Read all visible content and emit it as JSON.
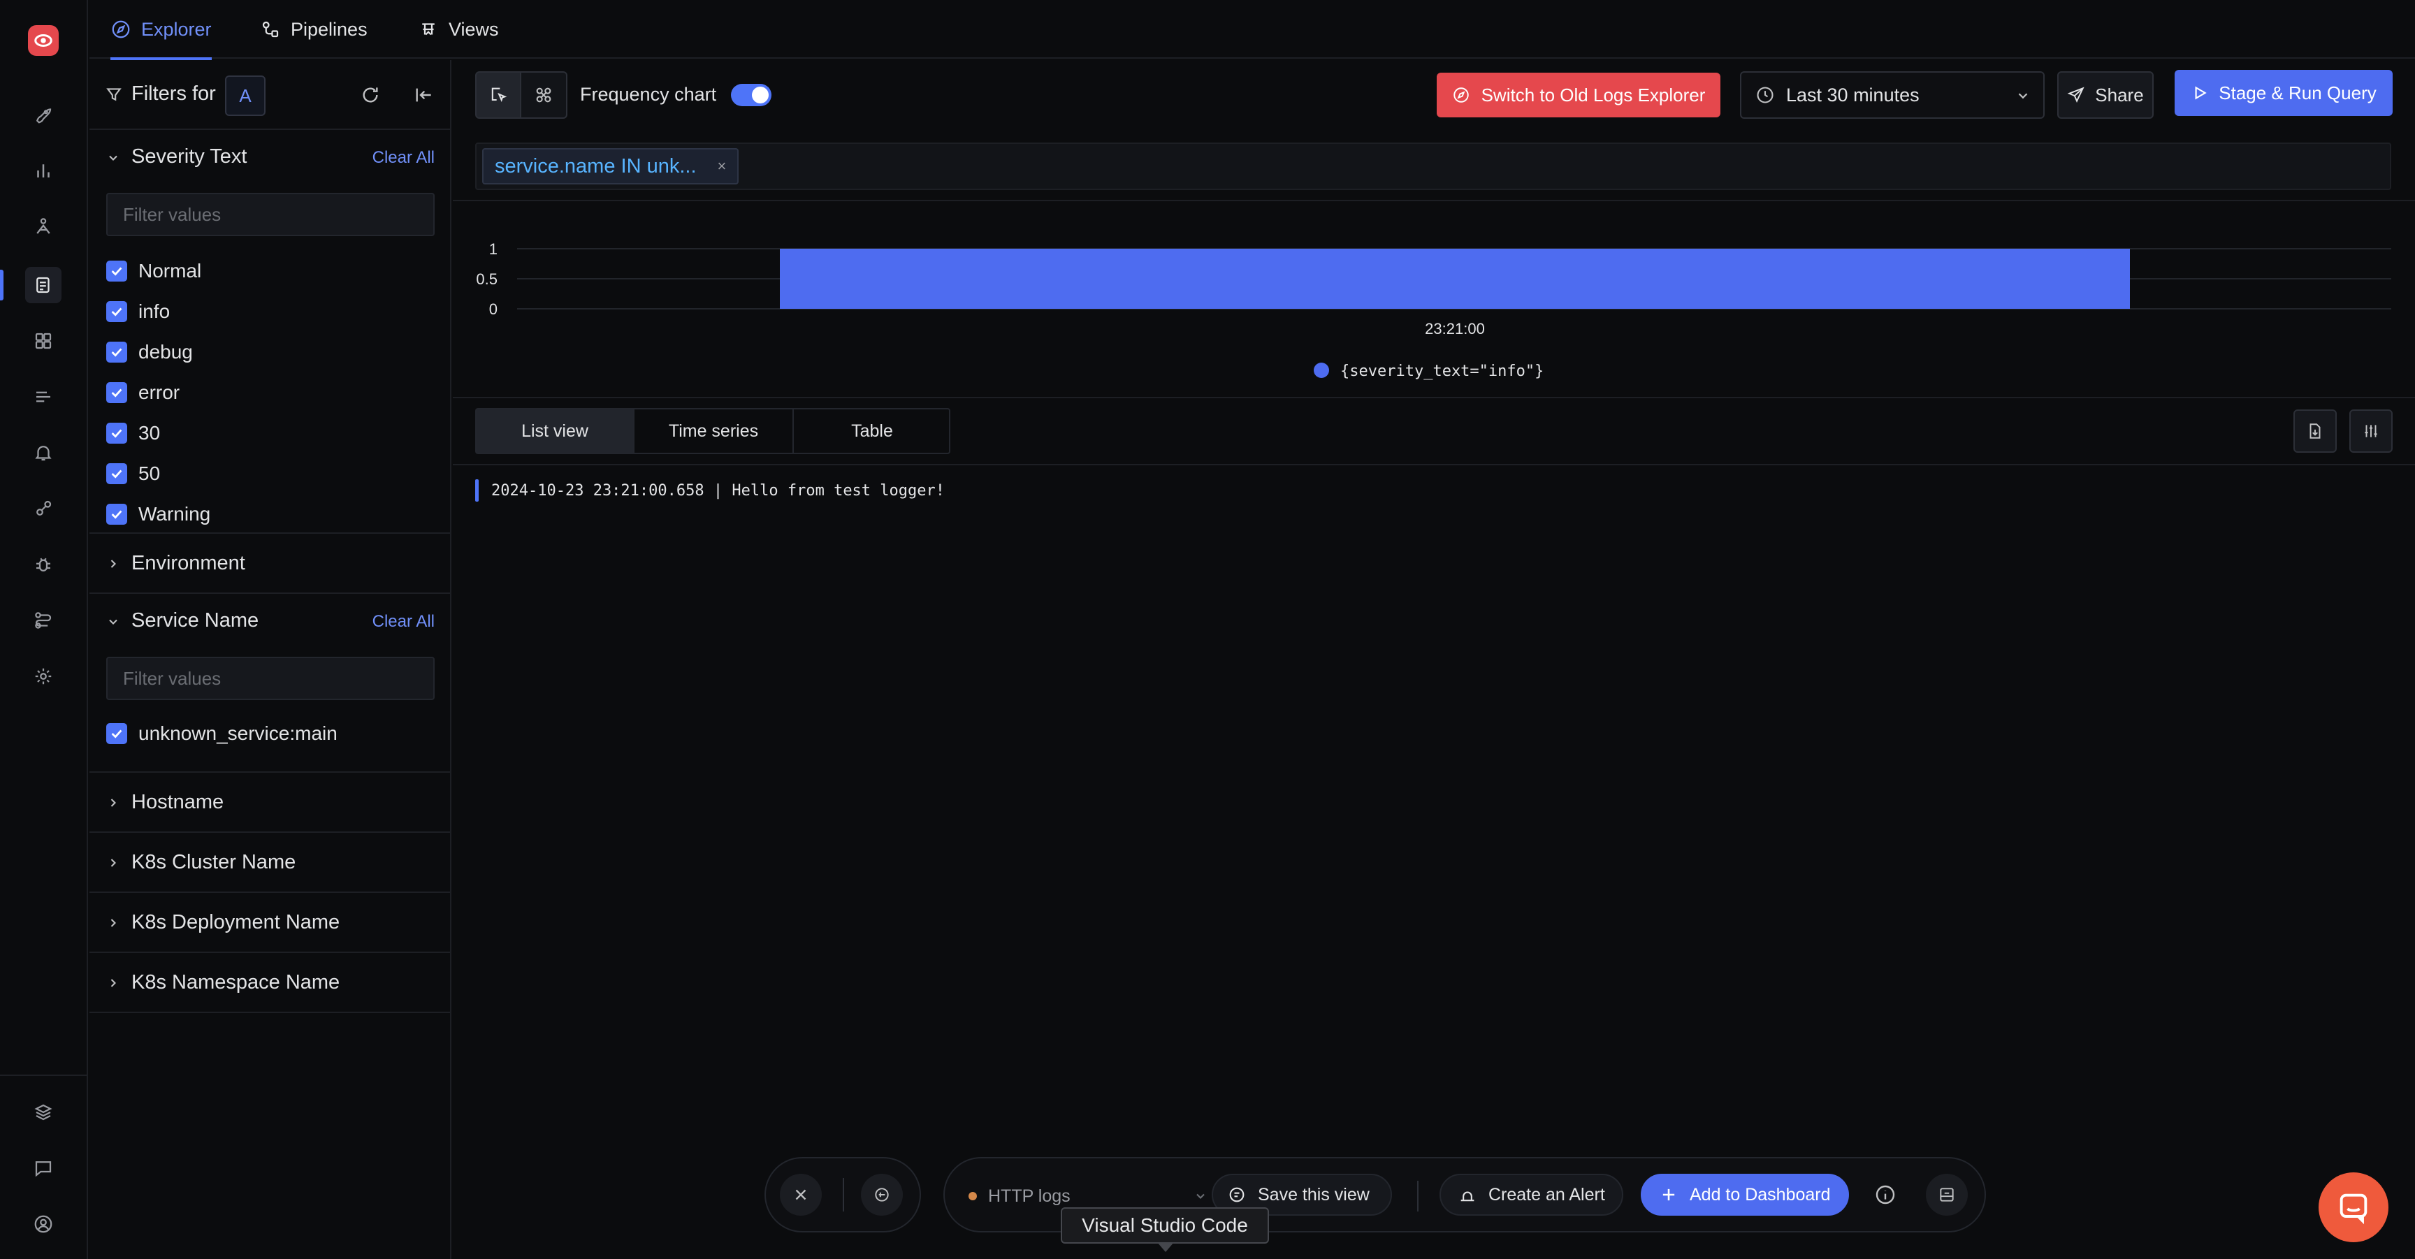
{
  "nav": {
    "tabs": [
      {
        "label": "Explorer",
        "icon": "compass-icon",
        "active": true
      },
      {
        "label": "Pipelines",
        "icon": "pipeline-icon",
        "active": false
      },
      {
        "label": "Views",
        "icon": "views-icon",
        "active": false
      }
    ]
  },
  "sidebar_rail": {
    "items": [
      "rocket-icon",
      "bar-chart-icon",
      "traces-icon",
      "logs-icon",
      "dashboard-icon",
      "list-icon",
      "alert-bell-icon",
      "integrations-icon",
      "bug-icon",
      "workflow-icon",
      "settings-icon"
    ],
    "bottom_items": [
      "layers-icon",
      "chat-icon",
      "user-circle-icon"
    ],
    "active_index": 3
  },
  "filters": {
    "title": "Filters for",
    "query_badge": "A",
    "sections": {
      "severity": {
        "title": "Severity Text",
        "clear_label": "Clear All",
        "placeholder": "Filter values",
        "values": [
          "Normal",
          "info",
          "debug",
          "error",
          "30",
          "50",
          "Warning"
        ]
      },
      "environment": {
        "title": "Environment"
      },
      "service": {
        "title": "Service Name",
        "clear_label": "Clear All",
        "placeholder": "Filter values",
        "values": [
          "unknown_service:main"
        ]
      },
      "hostname": {
        "title": "Hostname"
      },
      "k8s_cluster": {
        "title": "K8s Cluster Name"
      },
      "k8s_deployment": {
        "title": "K8s Deployment Name"
      },
      "k8s_namespace": {
        "title": "K8s Namespace Name"
      }
    }
  },
  "toolbar": {
    "frequency_label": "Frequency chart",
    "frequency_on": true,
    "switch_old_label": "Switch to Old Logs Explorer",
    "time_range": "Last 30 minutes",
    "share_label": "Share",
    "run_label": "Stage & Run Query"
  },
  "query": {
    "tag_text": "service.name IN unk...",
    "tag_close": "×"
  },
  "chart_data": {
    "type": "bar",
    "categories": [
      "23:21:00"
    ],
    "series": [
      {
        "name": "{severity_text=\"info\"}",
        "values": [
          1
        ],
        "color": "#4e6cf0"
      }
    ],
    "y_ticks": [
      "1",
      "0.5",
      "0"
    ],
    "x_tick_labels": [
      "23:21:00"
    ],
    "ylim": [
      0,
      1
    ],
    "legend_position": "bottom-center",
    "grid": true
  },
  "views": {
    "tabs": [
      "List view",
      "Time series",
      "Table"
    ],
    "active": "List view"
  },
  "logs": [
    {
      "text": "2024-10-23 23:21:00.658 | Hello from test logger!"
    }
  ],
  "actions": {
    "source_label": "HTTP logs",
    "save_view_label": "Save this view",
    "create_alert_label": "Create an Alert",
    "add_dashboard_label": "Add to Dashboard"
  },
  "tooltip": {
    "text": "Visual Studio Code"
  },
  "colors": {
    "accent": "#4e74f8",
    "danger": "#e5484d",
    "bar": "#4e6cf0",
    "chat": "#ef5a3c"
  }
}
